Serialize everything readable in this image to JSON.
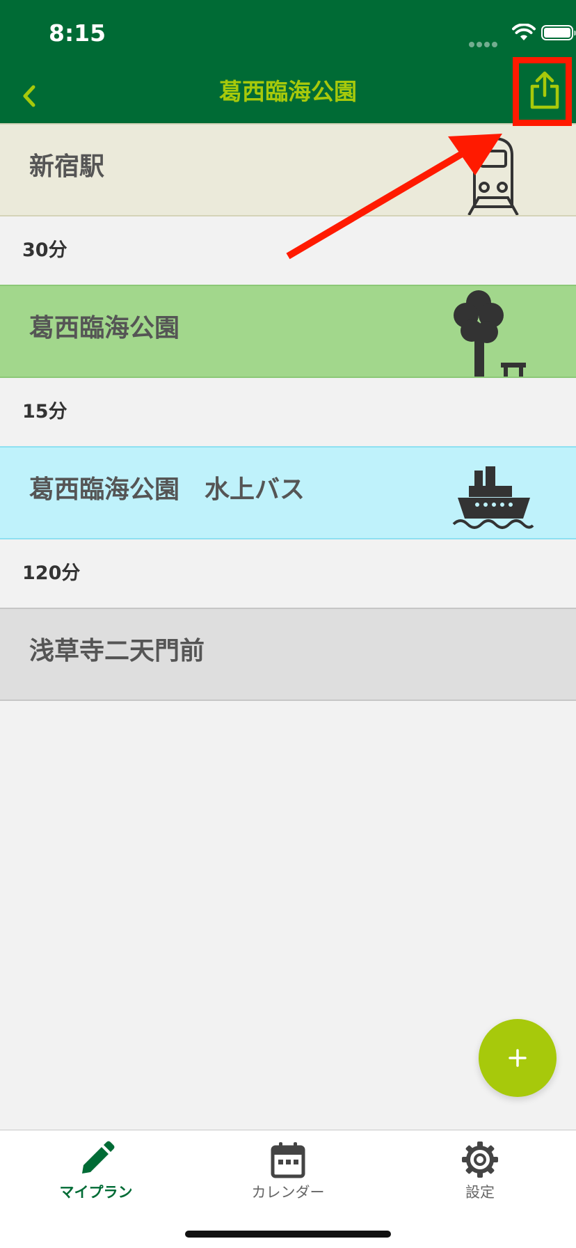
{
  "status_bar": {
    "time": "8:15"
  },
  "nav": {
    "title": "葛西臨海公園",
    "back_icon": "chevron-left-icon",
    "share_icon": "share-icon"
  },
  "plan": [
    {
      "name": "新宿駅",
      "icon": "train-icon",
      "background": "#ebeada",
      "border": "#d4d3b8"
    },
    {
      "travel_time": "30分"
    },
    {
      "name": "葛西臨海公園",
      "icon": "park-tree-icon",
      "background": "#a2d78c",
      "border": "#8cc877"
    },
    {
      "travel_time": "15分"
    },
    {
      "name": "葛西臨海公園　水上バス",
      "icon": "ferry-icon",
      "background": "#bff2fb",
      "border": "#8ee0f1"
    },
    {
      "travel_time": "120分"
    },
    {
      "name": "浅草寺二天門前",
      "background": "#dedede",
      "border": "#c6c6c6"
    }
  ],
  "fab": {
    "label": "+"
  },
  "tabs": [
    {
      "label": "マイプラン",
      "icon": "pencil-icon",
      "active": true
    },
    {
      "label": "カレンダー",
      "icon": "calendar-icon",
      "active": false
    },
    {
      "label": "設定",
      "icon": "gear-icon",
      "active": false
    }
  ],
  "colors": {
    "header_bg": "#006b35",
    "accent": "#a7c90b",
    "annotation_red": "#ff1a00",
    "page_bg": "#f2f2f2"
  }
}
